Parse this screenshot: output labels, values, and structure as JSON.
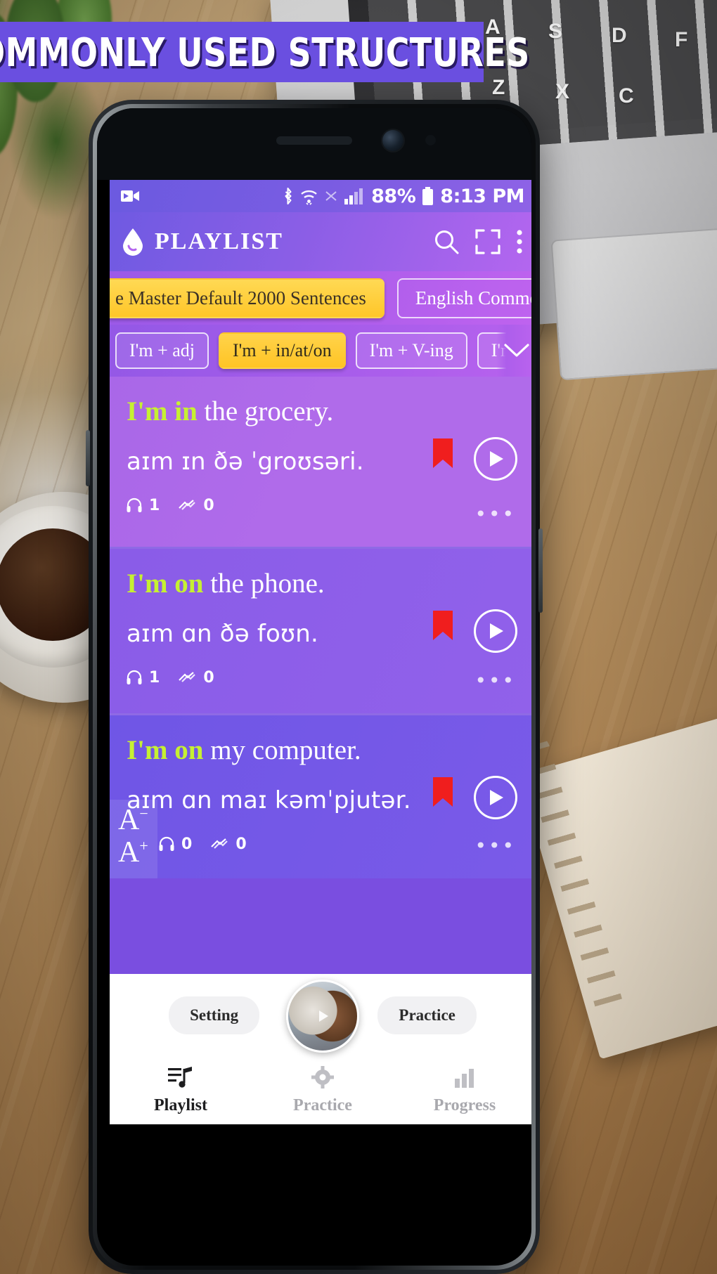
{
  "banner": {
    "text": "COMMONLY USED STRUCTURES",
    "bg_color": "#6a4fe0",
    "text_color": "#ffffff"
  },
  "status_bar": {
    "recording_icon": "video-camera-icon",
    "bluetooth_icon": "bluetooth-icon",
    "wifi_icon": "wifi-icon",
    "mute_icon": "mute-icon",
    "signal_icon": "signal-bars-icon",
    "battery_percent": "88%",
    "battery_icon": "battery-icon",
    "time": "8:13 PM"
  },
  "toolbar": {
    "logo_icon": "water-drop-icon",
    "title": "PLAYLIST",
    "search_icon": "search-icon",
    "fullscreen_icon": "fullscreen-icon",
    "overflow_icon": "more-vertical-icon"
  },
  "tabs": [
    {
      "label": "e Master Default 2000 Sentences",
      "selected": true
    },
    {
      "label": "English Common",
      "selected": false
    }
  ],
  "chips": [
    {
      "label": "I'm + adj",
      "selected": false
    },
    {
      "label": "I'm + in/at/on",
      "selected": true
    },
    {
      "label": "I'm + V-ing",
      "selected": false
    },
    {
      "label": "I'm",
      "selected": false
    }
  ],
  "chips_expand_icon": "chevron-down-icon",
  "sentences": [
    {
      "highlight": "I'm in",
      "rest": " the grocery.",
      "ipa": "aɪm ɪn ðə ˈgroʊsəri.",
      "listen_count": "1",
      "speak_count": "0",
      "bookmark_icon": "bookmark-icon",
      "play_icon": "play-icon",
      "overflow_icon": "more-horizontal-icon"
    },
    {
      "highlight": "I'm on",
      "rest": " the phone.",
      "ipa": "aɪm ɑn ðə foʊn.",
      "listen_count": "1",
      "speak_count": "0",
      "bookmark_icon": "bookmark-icon",
      "play_icon": "play-icon",
      "overflow_icon": "more-horizontal-icon"
    },
    {
      "highlight": "I'm on",
      "rest": " my computer.",
      "ipa": "aɪm ɑn maɪ kəmˈpjutər.",
      "listen_count": "0",
      "speak_count": "0",
      "bookmark_icon": "bookmark-icon",
      "play_icon": "play-icon",
      "overflow_icon": "more-horizontal-icon"
    }
  ],
  "font_size_controls": {
    "decrease": "A",
    "decrease_sup": "−",
    "increase": "A",
    "increase_sup": "+"
  },
  "quick_actions": {
    "setting_label": "Setting",
    "practice_label": "Practice",
    "avatar_icon": "avatar-play-icon"
  },
  "bottom_nav": [
    {
      "label": "Playlist",
      "icon": "playlist-music-icon",
      "active": true
    },
    {
      "label": "Practice",
      "icon": "gear-icon",
      "active": false
    },
    {
      "label": "Progress",
      "icon": "bar-chart-icon",
      "active": false
    }
  ],
  "colors": {
    "accent_yellow": "#ffc629",
    "highlight_green": "#c6f032",
    "bookmark_red": "#f01e1e",
    "purple_top": "#6b5ae0",
    "purple_bottom": "#7a5ae8"
  }
}
